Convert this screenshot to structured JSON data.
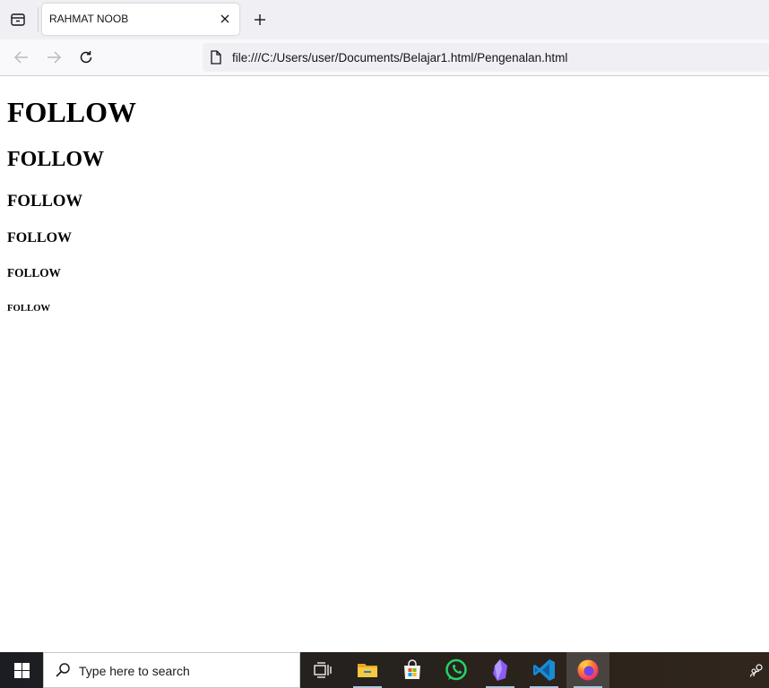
{
  "browser": {
    "tab": {
      "title": "RAHMAT NOOB"
    },
    "url": "file:///C:/Users/user/Documents/Belajar1.html/Pengenalan.html",
    "icons": [
      "tab-list-icon",
      "close-icon",
      "plus-icon",
      "back-arrow-icon",
      "forward-arrow-icon",
      "reload-icon",
      "page-icon"
    ]
  },
  "page": {
    "headings": {
      "h1": "FOLLOW",
      "h2": "FOLLOW",
      "h3": "FOLLOW",
      "h4": "FOLLOW",
      "h5": "FOLLOW",
      "h6": "FOLLOW"
    }
  },
  "taskbar": {
    "search_placeholder": "Type here to search",
    "apps": [
      "task-view",
      "file-explorer",
      "microsoft-store",
      "whatsapp",
      "obsidian",
      "vs-code",
      "firefox"
    ],
    "active_app": "firefox"
  },
  "colors": {
    "tabstrip_bg": "#f0f0f4",
    "navbar_bg": "#f9f9fb",
    "taskbar_bg": "#1c1d22",
    "whatsapp": "#25d366",
    "vscode": "#1a8ad6",
    "obsidian": "#8a5cf5"
  }
}
